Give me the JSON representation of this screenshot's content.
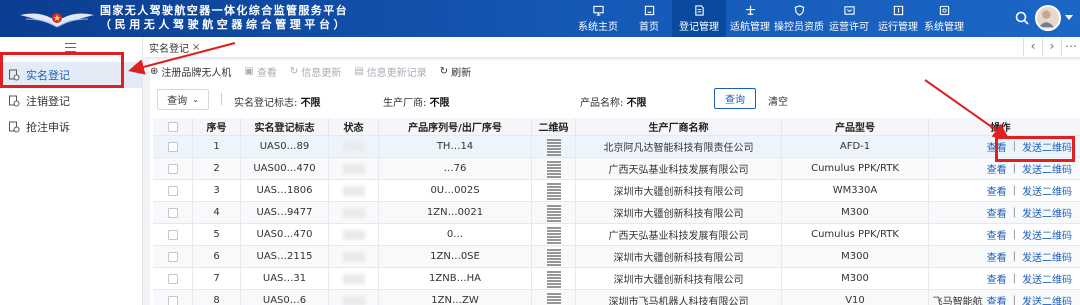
{
  "header": {
    "title": "国家无人驾驶航空器一体化综合监管服务平台",
    "subtitle": "（民用无人驾驶航空器综合管理平台）",
    "nav": [
      {
        "label": "系统主页",
        "icon": "monitor-icon"
      },
      {
        "label": "首页",
        "icon": "home-icon"
      },
      {
        "label": "登记管理",
        "icon": "register-icon",
        "active": true
      },
      {
        "label": "适航管理",
        "icon": "plane-icon"
      },
      {
        "label": "操控员资质",
        "icon": "shield-icon"
      },
      {
        "label": "运营许可",
        "icon": "license-icon"
      },
      {
        "label": "运行管理",
        "icon": "flight-icon"
      },
      {
        "label": "系统管理",
        "icon": "settings-icon"
      }
    ]
  },
  "sidebar": {
    "items": [
      {
        "label": "实名登记",
        "icon": "register-doc-icon",
        "active": true
      },
      {
        "label": "注销登记",
        "icon": "cancel-doc-icon"
      },
      {
        "label": "抢注申诉",
        "icon": "appeal-doc-icon"
      }
    ]
  },
  "tabs": [
    {
      "label": "实名登记"
    }
  ],
  "toolbar": {
    "items": [
      {
        "label": "注册品牌无人机",
        "icon": "⊕",
        "enabled": true
      },
      {
        "label": "查看",
        "icon": "▣",
        "enabled": false
      },
      {
        "label": "信息更新",
        "icon": "↻",
        "enabled": false
      },
      {
        "label": "信息更新记录",
        "icon": "▤",
        "enabled": false
      },
      {
        "label": "刷新",
        "icon": "↻",
        "enabled": true
      }
    ]
  },
  "filter": {
    "query_label": "查询",
    "status_label": "实名登记标志:",
    "status_value": "不限",
    "maker_label": "生产厂商:",
    "maker_value": "不限",
    "product_label": "产品名称:",
    "product_value": "不限",
    "search_label": "查询",
    "clear_label": "清空"
  },
  "table": {
    "columns": [
      "序号",
      "实名登记标志",
      "状态",
      "产品序列号/出厂序号",
      "二维码",
      "生产厂商名称",
      "产品型号",
      "操作"
    ],
    "rows": [
      {
        "no": "1",
        "reg": "UAS0…89",
        "status": "",
        "serial": "TH…14",
        "maker": "北京阿凡达智能科技有限责任公司",
        "model": "AFD-1"
      },
      {
        "no": "2",
        "reg": "UAS00…470",
        "status": "",
        "serial": "…76",
        "maker": "广西天弘基业科技发展有限公司",
        "model": "Cumulus PPK/RTK"
      },
      {
        "no": "3",
        "reg": "UAS…1806",
        "status": "",
        "serial": "0U…002S",
        "maker": "深圳市大疆创新科技有限公司",
        "model": "WM330A"
      },
      {
        "no": "4",
        "reg": "UAS…9477",
        "status": "",
        "serial": "1ZN…0021",
        "maker": "深圳市大疆创新科技有限公司",
        "model": "M300"
      },
      {
        "no": "5",
        "reg": "UAS0…470",
        "status": "",
        "serial": "0…",
        "maker": "广西天弘基业科技发展有限公司",
        "model": "Cumulus PPK/RTK"
      },
      {
        "no": "6",
        "reg": "UAS…2115",
        "status": "",
        "serial": "1ZN…0SE",
        "maker": "深圳市大疆创新科技有限公司",
        "model": "M300"
      },
      {
        "no": "7",
        "reg": "UAS…31",
        "status": "",
        "serial": "1ZNB…HA",
        "maker": "深圳市大疆创新科技有限公司",
        "model": "M300"
      },
      {
        "no": "8",
        "reg": "UAS0…6",
        "status": "",
        "serial": "1ZN…ZW",
        "maker": "深圳市飞马机器人科技有限公司",
        "model": "V10"
      }
    ],
    "actions": {
      "view": "查看",
      "sep": "|",
      "send": "发送二维码"
    },
    "row8_extra": "飞马智能航"
  }
}
